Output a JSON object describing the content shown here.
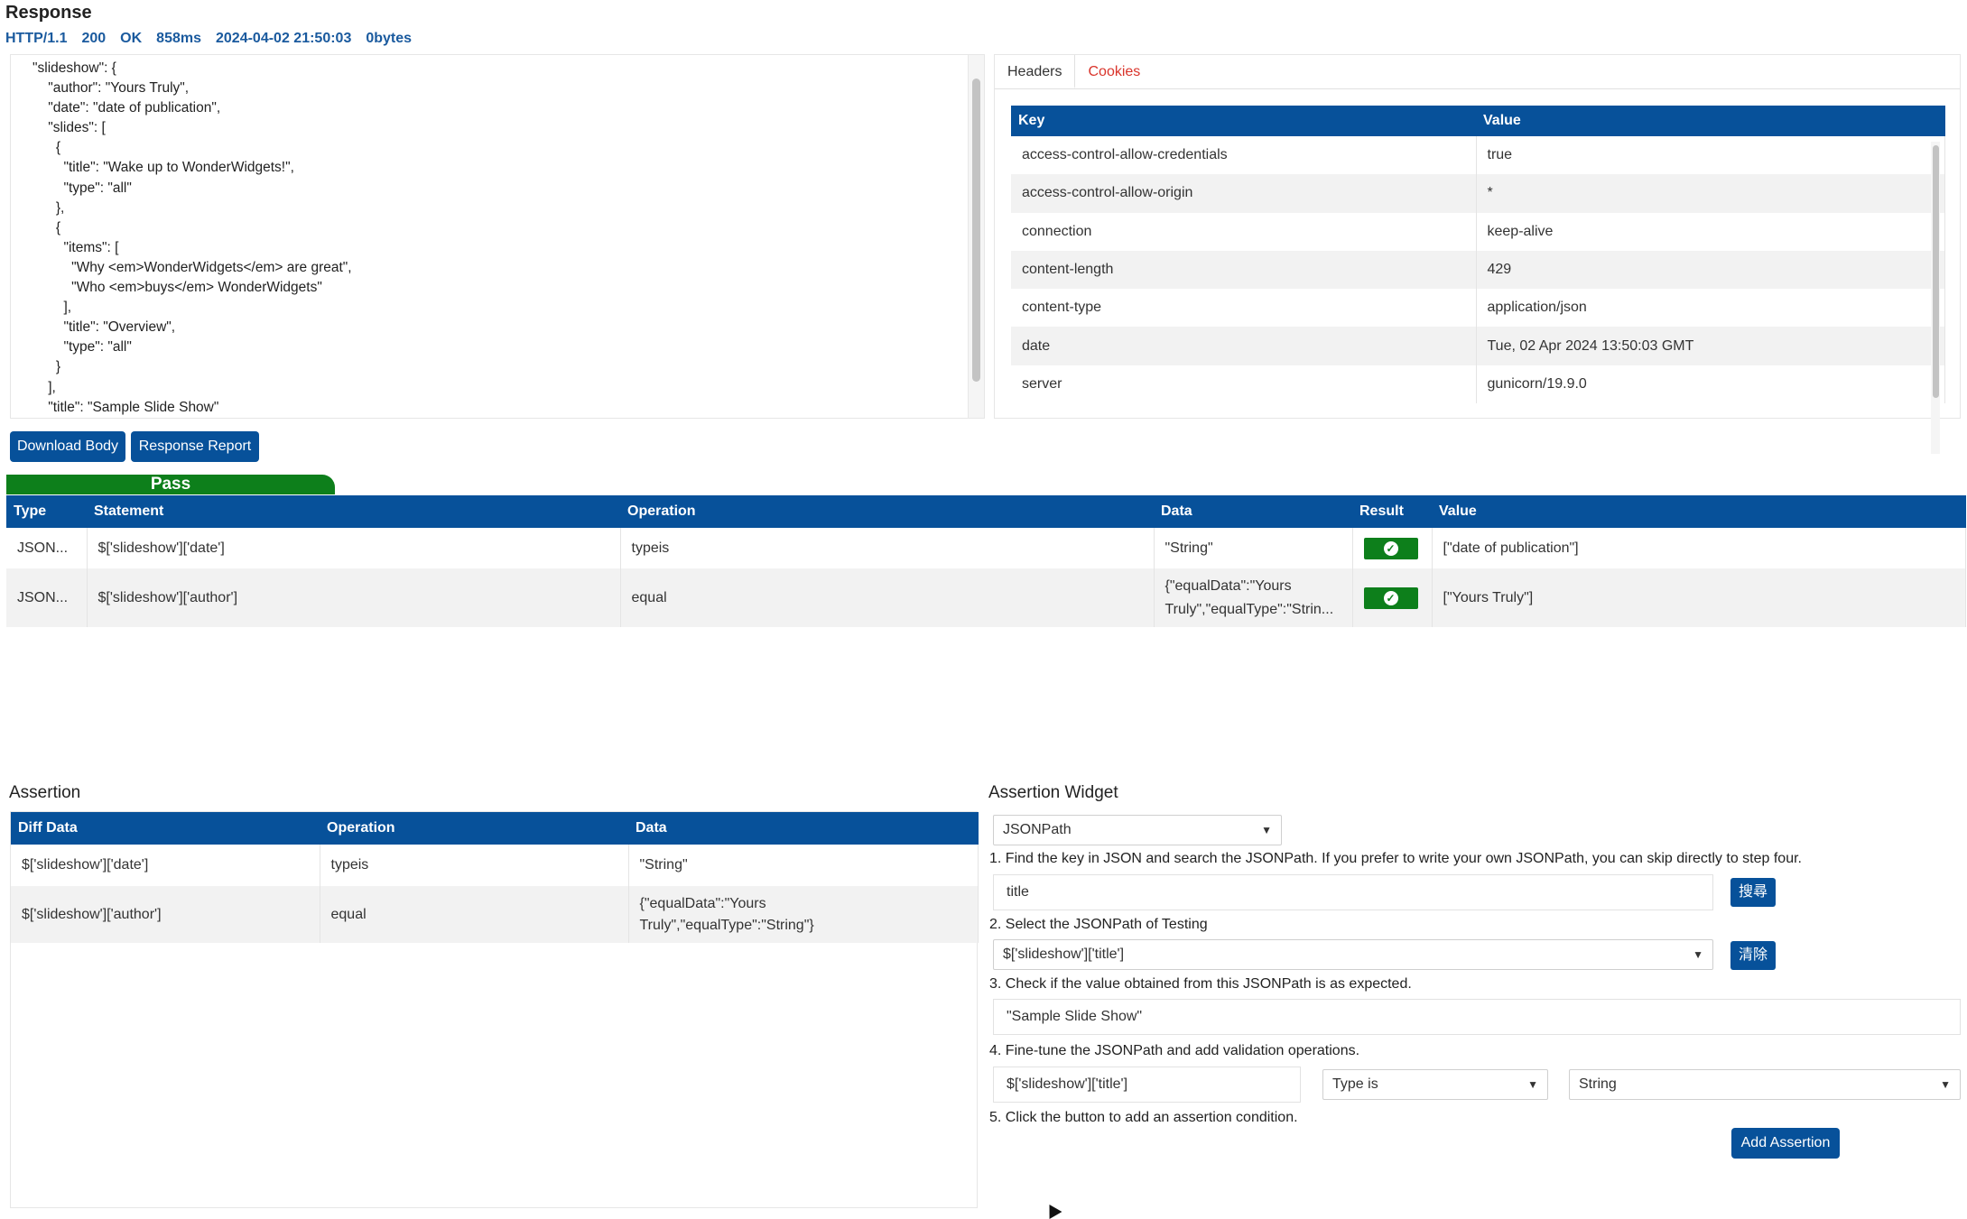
{
  "response": {
    "title": "Response",
    "status": {
      "protocol": "HTTP/1.1",
      "code": "200",
      "text": "OK",
      "time": "858ms",
      "datetime": "2024-04-02 21:50:03",
      "size": "0bytes"
    },
    "body_text": "\"slideshow\": {\n    \"author\": \"Yours Truly\",\n    \"date\": \"date of publication\",\n    \"slides\": [\n      {\n        \"title\": \"Wake up to WonderWidgets!\",\n        \"type\": \"all\"\n      },\n      {\n        \"items\": [\n          \"Why <em>WonderWidgets</em> are great\",\n          \"Who <em>buys</em> WonderWidgets\"\n        ],\n        \"title\": \"Overview\",\n        \"type\": \"all\"\n      }\n    ],\n    \"title\": \"Sample Slide Show\""
  },
  "headers_panel": {
    "tabs": [
      "Headers",
      "Cookies"
    ],
    "active_tab": "Headers",
    "columns": [
      "Key",
      "Value"
    ],
    "rows": [
      {
        "key": "access-control-allow-credentials",
        "value": "true"
      },
      {
        "key": "access-control-allow-origin",
        "value": "*"
      },
      {
        "key": "connection",
        "value": "keep-alive"
      },
      {
        "key": "content-length",
        "value": "429"
      },
      {
        "key": "content-type",
        "value": "application/json"
      },
      {
        "key": "date",
        "value": "Tue, 02 Apr 2024 13:50:03 GMT"
      },
      {
        "key": "server",
        "value": "gunicorn/19.9.0"
      }
    ]
  },
  "actions": {
    "download_body": "Download Body",
    "response_report": "Response Report"
  },
  "results": {
    "status_label": "Pass",
    "columns": [
      "Type",
      "Statement",
      "Operation",
      "Data",
      "Result",
      "Value"
    ],
    "rows": [
      {
        "type": "JSON...",
        "statement": "$['slideshow']['date']",
        "operation": "typeis",
        "data": "\"String\"",
        "result": "pass",
        "value": "[\"date of publication\"]"
      },
      {
        "type": "JSON...",
        "statement": "$['slideshow']['author']",
        "operation": "equal",
        "data_line1": "{\"equalData\":\"Yours",
        "data_line2": "Truly\",\"equalType\":\"Strin...",
        "result": "pass",
        "value": "[\"Yours Truly\"]"
      }
    ]
  },
  "assertion": {
    "title": "Assertion",
    "columns": [
      "Diff Data",
      "Operation",
      "Data"
    ],
    "rows": [
      {
        "diff": "$['slideshow']['date']",
        "operation": "typeis",
        "data": "\"String\""
      },
      {
        "diff": "$['slideshow']['author']",
        "operation": "equal",
        "data_line1": "{\"equalData\":\"Yours",
        "data_line2": "Truly\",\"equalType\":\"String\"}"
      }
    ]
  },
  "widget": {
    "title": "Assertion Widget",
    "type_select": "JSONPath",
    "step1": "1. Find the key in JSON and search the JSONPath. If you prefer to write your own JSONPath, you can skip directly to step four.",
    "search_value": "title",
    "search_button": "搜尋",
    "step2": "2. Select the JSONPath of Testing",
    "path_select": "$['slideshow']['title']",
    "clear_button": "清除",
    "step3": "3. Check if the value obtained from this JSONPath is as expected.",
    "expected_value": "\"Sample Slide Show\"",
    "step4": "4. Fine-tune the JSONPath and add validation operations.",
    "path_input": "$['slideshow']['title']",
    "operation_select": "Type is",
    "value_select": "String",
    "step5": "5. Click the button to add an assertion condition.",
    "add_button": "Add Assertion"
  },
  "icons": {
    "check": "check-circle-icon",
    "caret": "chevron-down-icon"
  },
  "colors": {
    "primary": "#07519a",
    "pass": "#0d7f1b",
    "tab_inactive": "#d9342b",
    "status_text": "#1a5a9e"
  }
}
